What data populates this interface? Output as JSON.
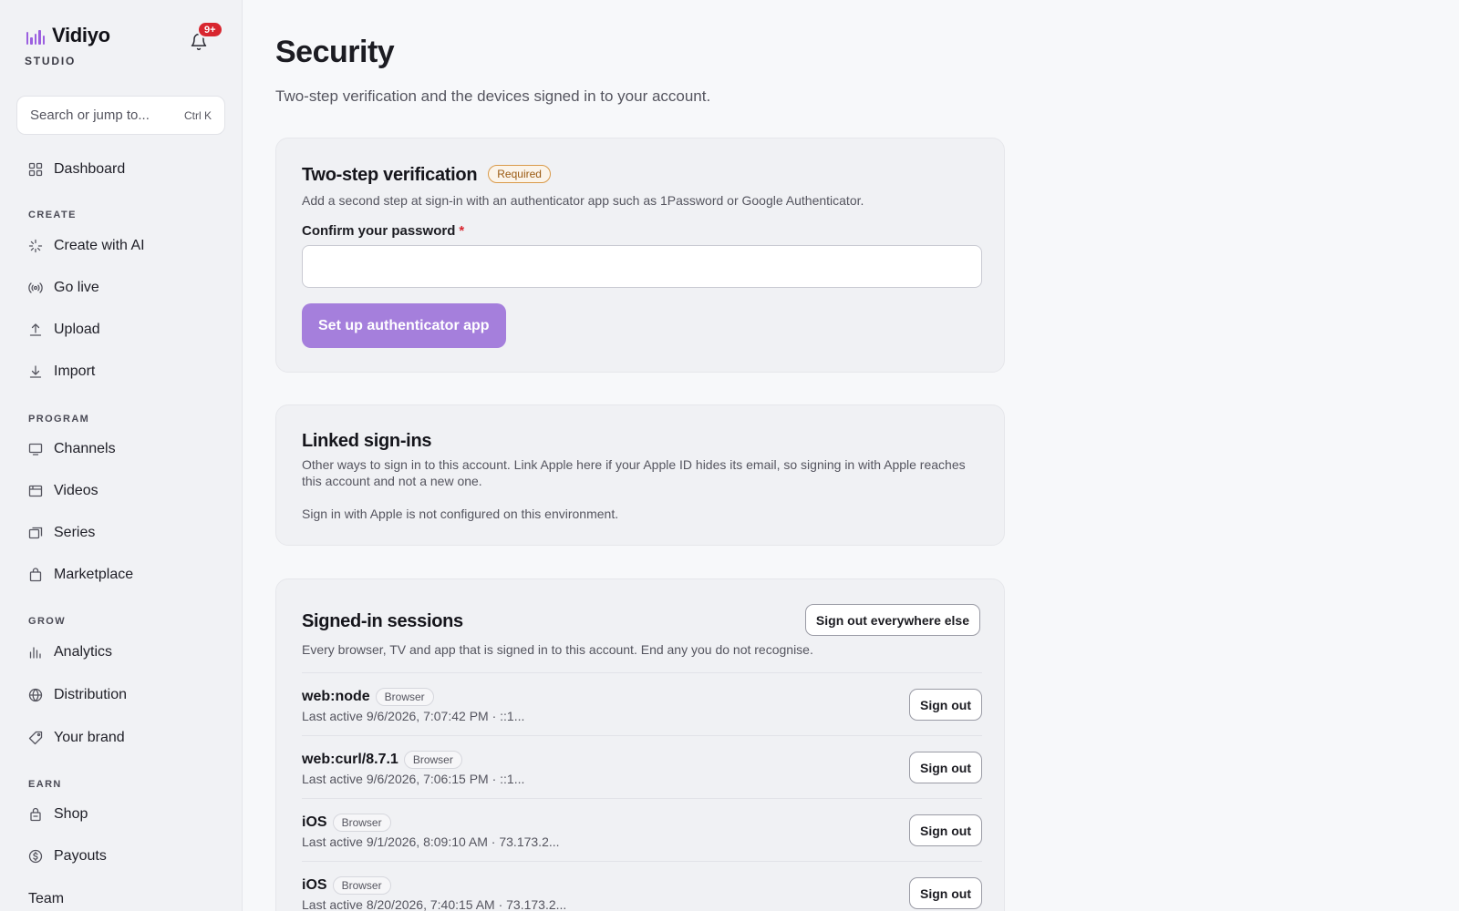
{
  "brand": {
    "name": "Vidiyo",
    "sub": "STUDIO",
    "accent": "#9b5fe0",
    "notification_count": "9+"
  },
  "search": {
    "placeholder": "Search or jump to...",
    "shortcut": "Ctrl K"
  },
  "sidebar": {
    "dashboard": "Dashboard",
    "sections": {
      "create": "CREATE",
      "program": "PROGRAM",
      "grow": "GROW",
      "earn": "EARN"
    },
    "create_items": [
      "Create with AI",
      "Go live",
      "Upload",
      "Import"
    ],
    "program_items": [
      "Channels",
      "Videos",
      "Series",
      "Marketplace"
    ],
    "grow_items": [
      "Analytics",
      "Distribution",
      "Your brand"
    ],
    "earn_items": [
      "Shop",
      "Payouts"
    ],
    "team": "Team"
  },
  "page": {
    "title": "Security",
    "subtitle": "Two-step verification and the devices signed in to your account."
  },
  "two_step": {
    "title": "Two-step verification",
    "badge": "Required",
    "description": "Add a second step at sign-in with an authenticator app such as 1Password or Google Authenticator.",
    "password_label": "Confirm your password",
    "required_mark": "*",
    "password_value": "",
    "button": "Set up authenticator app"
  },
  "linked": {
    "title": "Linked sign-ins",
    "description": "Other ways to sign in to this account. Link Apple here if your Apple ID hides its email, so signing in with Apple reaches this account and not a new one.",
    "note": "Sign in with Apple is not configured on this environment."
  },
  "sessions": {
    "title": "Signed-in sessions",
    "sign_out_all": "Sign out everywhere else",
    "description": "Every browser, TV and app that is signed in to this account. End any you do not recognise.",
    "items": [
      {
        "name": "web:node",
        "type": "Browser",
        "meta": "Last active 9/6/2026, 7:07:42 PM · ::1...",
        "action": "Sign out"
      },
      {
        "name": "web:curl/8.7.1",
        "type": "Browser",
        "meta": "Last active 9/6/2026, 7:06:15 PM · ::1...",
        "action": "Sign out"
      },
      {
        "name": "iOS",
        "type": "Browser",
        "meta": "Last active 9/1/2026, 8:09:10 AM · 73.173.2...",
        "action": "Sign out"
      },
      {
        "name": "iOS",
        "type": "Browser",
        "meta": "Last active 8/20/2026, 7:40:15 AM · 73.173.2...",
        "action": "Sign out"
      }
    ]
  }
}
